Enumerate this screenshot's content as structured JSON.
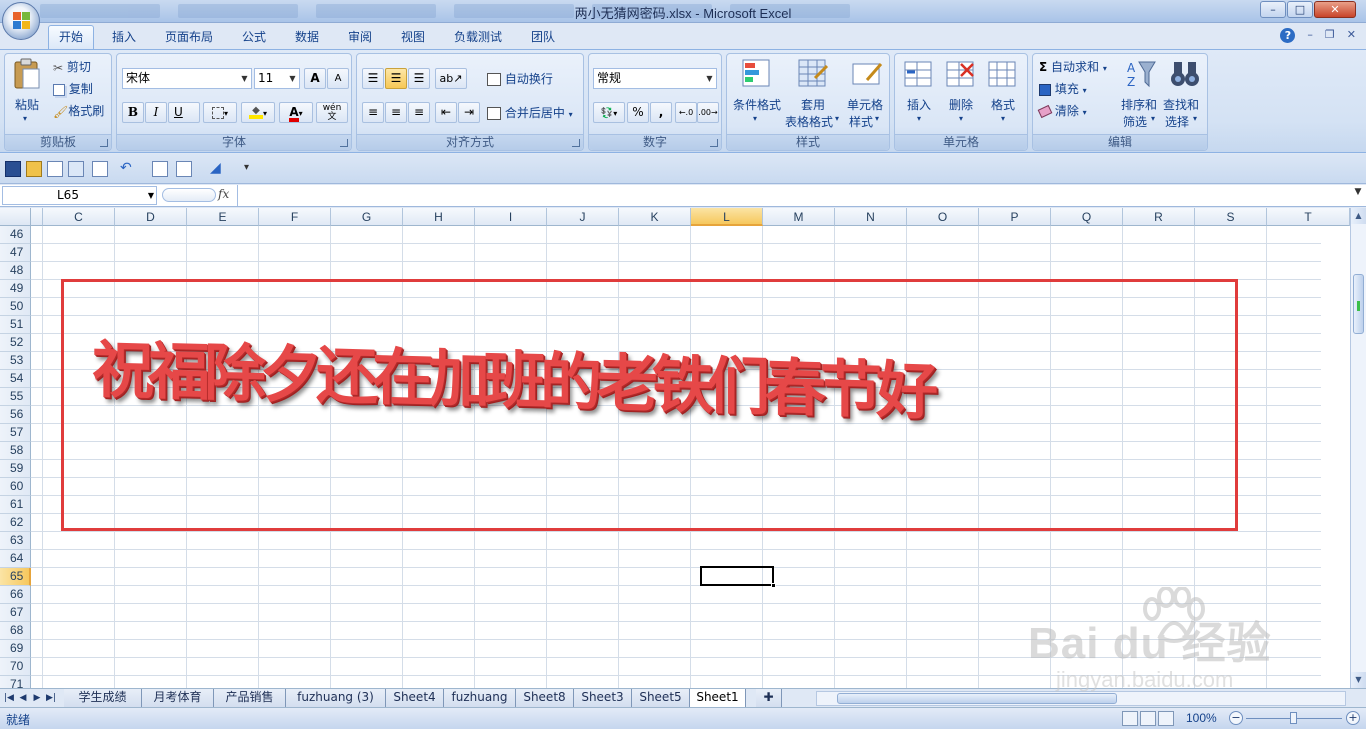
{
  "window": {
    "title": "两小无猜网密码.xlsx - Microsoft Excel",
    "min": "–",
    "max": "□",
    "close": "✕"
  },
  "tabs": [
    "开始",
    "插入",
    "页面布局",
    "公式",
    "数据",
    "审阅",
    "视图",
    "负载测试",
    "团队"
  ],
  "help": {
    "min": "–",
    "restore": "❐",
    "close": "✕"
  },
  "ribbon": {
    "clipboard": {
      "label": "剪贴板",
      "paste": "粘贴",
      "cut": "剪切",
      "copy": "复制",
      "format_painter": "格式刷"
    },
    "font": {
      "label": "字体",
      "name": "宋体",
      "size": "11",
      "grow": "A",
      "shrink": "A",
      "bold": "B",
      "italic": "I",
      "underline": "U",
      "font_color": "A",
      "phonetic": "wén"
    },
    "alignment": {
      "label": "对齐方式",
      "wrap": "自动换行",
      "merge": "合并后居中"
    },
    "number": {
      "label": "数字",
      "format": "常规",
      "percent": "%",
      "comma": ","
    },
    "styles": {
      "label": "样式",
      "cond": "条件格式",
      "table1": "套用",
      "table2": "表格格式",
      "cell1": "单元格",
      "cell2": "样式"
    },
    "cells": {
      "label": "单元格",
      "insert": "插入",
      "delete": "删除",
      "format": "格式"
    },
    "editing": {
      "label": "编辑",
      "autosum": "自动求和",
      "fill": "填充",
      "clear": "清除",
      "sort1": "排序和",
      "sort2": "筛选",
      "find1": "查找和",
      "find2": "选择"
    }
  },
  "formula_bar": {
    "name_box": "L65",
    "fx": "fx",
    "formula": ""
  },
  "columns": [
    "C",
    "D",
    "E",
    "F",
    "G",
    "H",
    "I",
    "J",
    "K",
    "L",
    "M",
    "N",
    "O",
    "P",
    "Q",
    "R",
    "S",
    "T"
  ],
  "selected_column": "L",
  "rows": [
    "46",
    "47",
    "48",
    "49",
    "50",
    "51",
    "52",
    "53",
    "54",
    "55",
    "56",
    "57",
    "58",
    "59",
    "60",
    "61",
    "62",
    "63",
    "64",
    "65",
    "66",
    "67",
    "68",
    "69",
    "70",
    "71"
  ],
  "selected_row": "65",
  "banner_text": "祝福除夕还在加班的老铁们春节好",
  "sheets": [
    "学生成绩",
    "月考体育",
    "产品销售",
    "fuzhuang (3)",
    "Sheet4",
    "fuzhuang",
    "Sheet8",
    "Sheet3",
    "Sheet5",
    "Sheet1"
  ],
  "active_sheet": "Sheet1",
  "status": {
    "mode": "就绪",
    "zoom": "100%",
    "zoom_minus": "−",
    "zoom_plus": "+"
  },
  "watermark": {
    "brand": "Bai  du 经验",
    "url": "jingyan.baidu.com"
  },
  "colors": {
    "accent": "#15428b",
    "banner_red": "#e64848",
    "box_red": "#e03c3c",
    "selected_header": "#f6c85e"
  }
}
